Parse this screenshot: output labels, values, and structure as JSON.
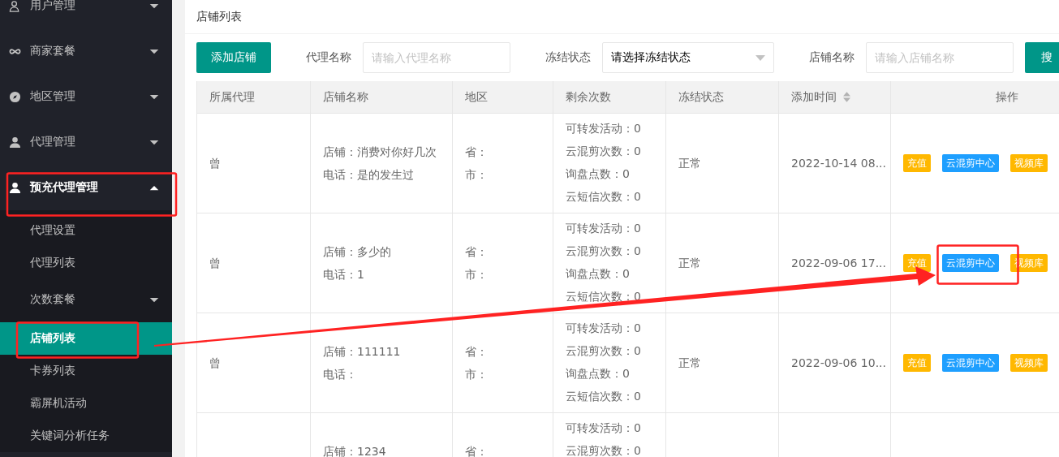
{
  "sidebar": {
    "items": [
      {
        "label": "用户管理",
        "kind": "user-outline",
        "expanded": false
      },
      {
        "label": "商家套餐",
        "kind": "infinity",
        "expanded": false
      },
      {
        "label": "地区管理",
        "kind": "compass",
        "expanded": false
      },
      {
        "label": "代理管理",
        "kind": "person",
        "expanded": false
      },
      {
        "label": "预充代理管理",
        "kind": "person",
        "expanded": true,
        "children": [
          {
            "label": "代理设置",
            "selected": false
          },
          {
            "label": "代理列表",
            "selected": false
          },
          {
            "label": "次数套餐",
            "selected": false,
            "expanded": false
          },
          {
            "label": "店铺列表",
            "selected": true
          },
          {
            "label": "卡券列表",
            "selected": false
          },
          {
            "label": "霸屏机活动",
            "selected": false
          },
          {
            "label": "关键词分析任务",
            "selected": false
          }
        ]
      }
    ]
  },
  "page_title": "店铺列表",
  "toolbar": {
    "add_button": "添加店铺",
    "filters": [
      {
        "kind": "input",
        "label": "代理名称",
        "placeholder": "请输入代理名称"
      },
      {
        "kind": "select",
        "label": "冻结状态",
        "value": "请选择冻结状态"
      },
      {
        "kind": "input",
        "label": "店铺名称",
        "placeholder": "请输入店铺名称"
      }
    ],
    "search_button": "搜"
  },
  "table": {
    "columns": [
      {
        "label": "所属代理"
      },
      {
        "label": "店铺名称"
      },
      {
        "label": "地区"
      },
      {
        "label": "剩余次数"
      },
      {
        "label": "冻结状态"
      },
      {
        "label": "添加时间",
        "sortable": true
      },
      {
        "label": "操作"
      }
    ],
    "rows": [
      {
        "agent": "曾",
        "shop": [
          "店铺：消费对你好几次",
          "电话：是的发生过"
        ],
        "region": [
          "省：",
          "市："
        ],
        "remaining": [
          "可转发活动：0",
          "云混剪次数：0",
          "询盘点数：0",
          "云短信次数：0"
        ],
        "status": "正常",
        "time": "2022-10-14 08...",
        "actions": [
          {
            "label": "充值",
            "kind": "warning"
          },
          {
            "label": "云混剪中心",
            "kind": "primary"
          },
          {
            "label": "视频库",
            "kind": "warning"
          }
        ]
      },
      {
        "agent": "曾",
        "shop": [
          "店铺：多少的",
          "电话：1"
        ],
        "region": [
          "省：",
          "市："
        ],
        "remaining": [
          "可转发活动：0",
          "云混剪次数：0",
          "询盘点数：0",
          "云短信次数：0"
        ],
        "status": "正常",
        "time": "2022-09-06 17...",
        "actions": [
          {
            "label": "充值",
            "kind": "warning"
          },
          {
            "label": "云混剪中心",
            "kind": "primary"
          },
          {
            "label": "视频库",
            "kind": "warning"
          }
        ]
      },
      {
        "agent": "曾",
        "shop": [
          "店铺：111111",
          "电话："
        ],
        "region": [
          "省：",
          "市："
        ],
        "remaining": [
          "可转发活动：0",
          "云混剪次数：0",
          "询盘点数：0",
          "云短信次数：0"
        ],
        "status": "正常",
        "time": "2022-09-06 10...",
        "actions": [
          {
            "label": "充值",
            "kind": "warning"
          },
          {
            "label": "云混剪中心",
            "kind": "primary"
          },
          {
            "label": "视频库",
            "kind": "warning"
          }
        ]
      },
      {
        "shop": [
          "店铺：1234"
        ],
        "region": [
          "省："
        ],
        "remaining": [
          "可转发活动：0",
          "云混剪次数：0"
        ]
      }
    ]
  }
}
